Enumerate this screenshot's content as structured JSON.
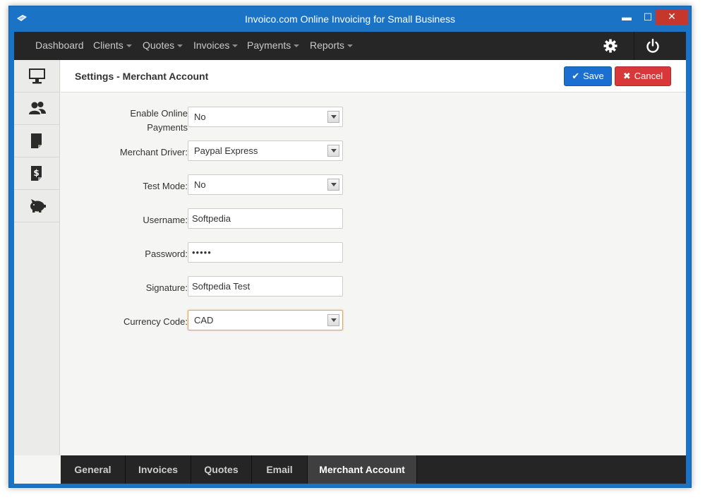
{
  "window": {
    "title": "Invoico.com Online Invoicing for Small Business",
    "minimize_glyph": "▬",
    "maximize_glyph": "☐",
    "close_glyph": "✕"
  },
  "navbar": {
    "items": [
      {
        "label": "Dashboard",
        "has_caret": false
      },
      {
        "label": "Clients",
        "has_caret": true
      },
      {
        "label": "Quotes",
        "has_caret": true
      },
      {
        "label": "Invoices",
        "has_caret": true
      },
      {
        "label": "Payments",
        "has_caret": true
      },
      {
        "label": "Reports",
        "has_caret": true
      }
    ],
    "right_icons": [
      "gear-icon",
      "power-icon"
    ]
  },
  "sidebar": {
    "items": [
      {
        "icon": "monitor-icon"
      },
      {
        "icon": "users-icon"
      },
      {
        "icon": "document-icon"
      },
      {
        "icon": "dollar-document-icon"
      },
      {
        "icon": "piggy-bank-icon"
      }
    ]
  },
  "header": {
    "title": "Settings - Merchant Account",
    "save_label": "Save",
    "cancel_label": "Cancel",
    "save_icon": "✔",
    "cancel_icon": "✖"
  },
  "form": {
    "enable_online_payments": {
      "label": "Enable Online Payments",
      "value": "No"
    },
    "merchant_driver": {
      "label": "Merchant Driver:",
      "value": "Paypal Express"
    },
    "test_mode": {
      "label": "Test Mode:",
      "value": "No"
    },
    "username": {
      "label": "Username:",
      "value": "Softpedia"
    },
    "password": {
      "label": "Password:",
      "value": "•••••"
    },
    "signature": {
      "label": "Signature:",
      "value": "Softpedia Test"
    },
    "currency_code": {
      "label": "Currency Code:",
      "value": "CAD"
    }
  },
  "tabs": [
    {
      "label": "General",
      "active": false
    },
    {
      "label": "Invoices",
      "active": false
    },
    {
      "label": "Quotes",
      "active": false
    },
    {
      "label": "Email",
      "active": false
    },
    {
      "label": "Merchant Account",
      "active": true
    }
  ],
  "colors": {
    "window_frame": "#1b73c5",
    "navbar": "#262626",
    "save_button": "#1a6fd0",
    "cancel_button": "#d9383a",
    "focus_border": "#e1a85d"
  }
}
